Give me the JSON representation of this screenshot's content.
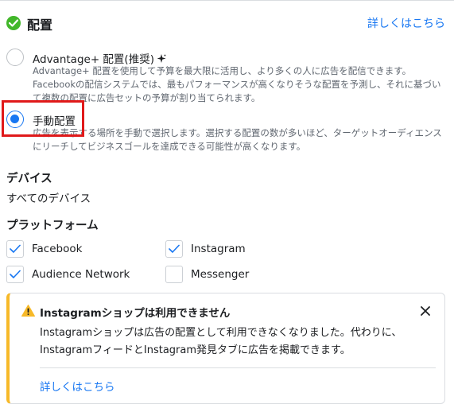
{
  "header": {
    "title": "配置",
    "link": "詳しくはこちら"
  },
  "options": {
    "advantage": {
      "title": "Advantage+ 配置(推奨)",
      "desc": "Advantage+ 配置を使用して予算を最大限に活用し、より多くの人に広告を配信できます。Facebookの配信システムでは、最もパフォーマンスが高くなりそうな配置を予測し、それに基づいて複数の配置に広告セットの予算が割り当てられます。",
      "selected": false
    },
    "manual": {
      "title": "手動配置",
      "desc": "広告を表示する場所を手動で選択します。選択する配置の数が多いほど、ターゲットオーディエンスにリーチしてビジネスゴールを達成できる可能性が高くなります。",
      "selected": true
    }
  },
  "devices": {
    "title": "デバイス",
    "value": "すべてのデバイス"
  },
  "platforms": {
    "title": "プラットフォーム",
    "items": [
      {
        "label": "Facebook",
        "checked": true
      },
      {
        "label": "Instagram",
        "checked": true
      },
      {
        "label": "Audience Network",
        "checked": true
      },
      {
        "label": "Messenger",
        "checked": false
      }
    ]
  },
  "alert": {
    "title": "Instagramショップは利用できません",
    "body": "Instagramショップは広告の配置として利用できなくなりました。代わりに、InstagramフィードとInstagram発見タブに広告を掲載できます。",
    "link": "詳しくはこちら"
  },
  "colors": {
    "accent": "#1877f2",
    "success": "#42b72a",
    "warning": "#f7b928",
    "highlight": "#e0191a"
  },
  "icons": {
    "header": "check-circle-icon",
    "sparkle": "sparkle-icon",
    "checkbox": "checkmark-icon",
    "warning": "warning-triangle-icon",
    "close": "close-icon"
  }
}
